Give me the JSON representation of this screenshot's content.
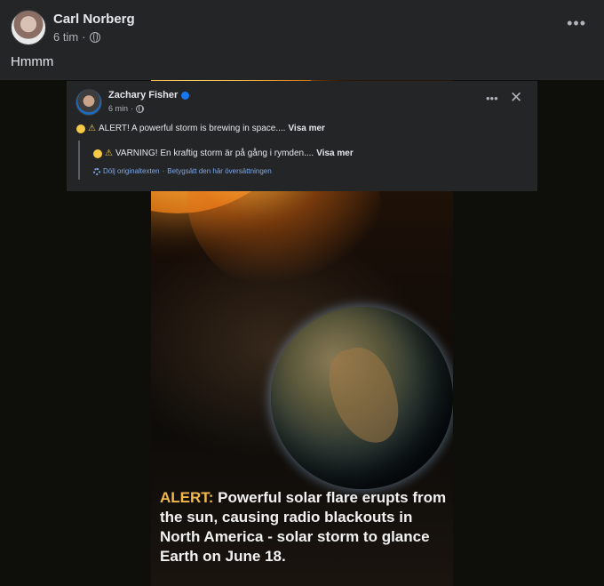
{
  "post": {
    "author": "Carl Norberg",
    "time": "6 tim",
    "separator": "·",
    "text": "Hmmm",
    "more_label": "•••"
  },
  "shared_post": {
    "author": "Zachary Fisher",
    "time": "6 min",
    "separator": "·",
    "more_label": "•••",
    "close_label": "✕",
    "text": "ALERT! A powerful storm is brewing in space....",
    "see_more": "Visa mer",
    "translation": {
      "text": "VARNING! En kraftig storm är på gång i rymden....",
      "see_more": "Visa mer",
      "hide_original": "Dölj originaltexten",
      "dot": "·",
      "rate": "Betygsätt den här översättningen"
    }
  },
  "image": {
    "caption_alert": "ALERT:",
    "caption_text": " Powerful solar flare erupts from the sun, causing radio blackouts in North America - solar storm to glance Earth on June 18."
  },
  "colors": {
    "background": "#242526",
    "text": "#e4e6eb",
    "secondary_text": "#b0b3b8",
    "link": "#7ea8e8",
    "verified": "#1877f2",
    "alert": "#f2b84b"
  },
  "icons": [
    "globe-icon",
    "verified-icon",
    "warning-icon",
    "gear-icon",
    "close-icon",
    "more-icon"
  ]
}
